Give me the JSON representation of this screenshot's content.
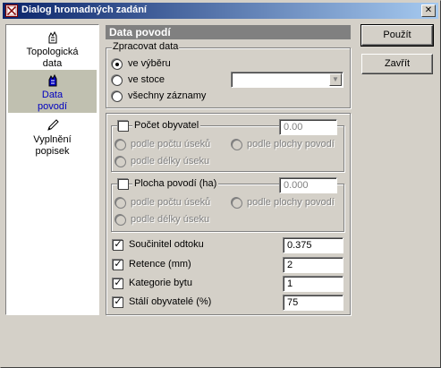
{
  "window": {
    "title": "Dialog hromadných zadání"
  },
  "sidebar": {
    "items": [
      {
        "label": "Topologická data",
        "line1": "Topologická",
        "line2": "data",
        "icon": "hand-map-icon"
      },
      {
        "label": "Data povodí",
        "line1": "Data",
        "line2": "povodí",
        "icon": "hand-map-icon",
        "active": true
      },
      {
        "label": "Vyplnění popisek",
        "line1": "Vyplnění",
        "line2": "popisek",
        "icon": "pencil-icon"
      }
    ]
  },
  "panel": {
    "title": "Data povodí"
  },
  "process": {
    "legend": "Zpracovat data",
    "options": [
      "ve výběru",
      "ve stoce",
      "všechny záznamy"
    ],
    "selected": "ve výběru",
    "sewer_value": ""
  },
  "population": {
    "label": "Počet obyvatel",
    "checked": false,
    "value": "0.00",
    "options": [
      "podle počtu úseků",
      "podle plochy povodí",
      "podle délky úseku"
    ]
  },
  "area": {
    "label": "Plocha povodí (ha)",
    "checked": false,
    "value": "0.000",
    "options": [
      "podle počtu úseků",
      "podle plochy povodí",
      "podle délky úseku"
    ]
  },
  "fields": [
    {
      "label": "Součinitel odtoku",
      "checked": true,
      "value": "0.375"
    },
    {
      "label": "Retence (mm)",
      "checked": true,
      "value": "2"
    },
    {
      "label": "Kategorie bytu",
      "checked": true,
      "value": "1"
    },
    {
      "label": "Stálí obyvatelé (%)",
      "checked": true,
      "value": "75"
    }
  ],
  "buttons": {
    "apply": "Použít",
    "close": "Zavřít"
  },
  "colors": {
    "titlebar_start": "#0a246a",
    "titlebar_end": "#a6caf0",
    "face": "#d4d0c8",
    "panel_header": "#808080"
  }
}
